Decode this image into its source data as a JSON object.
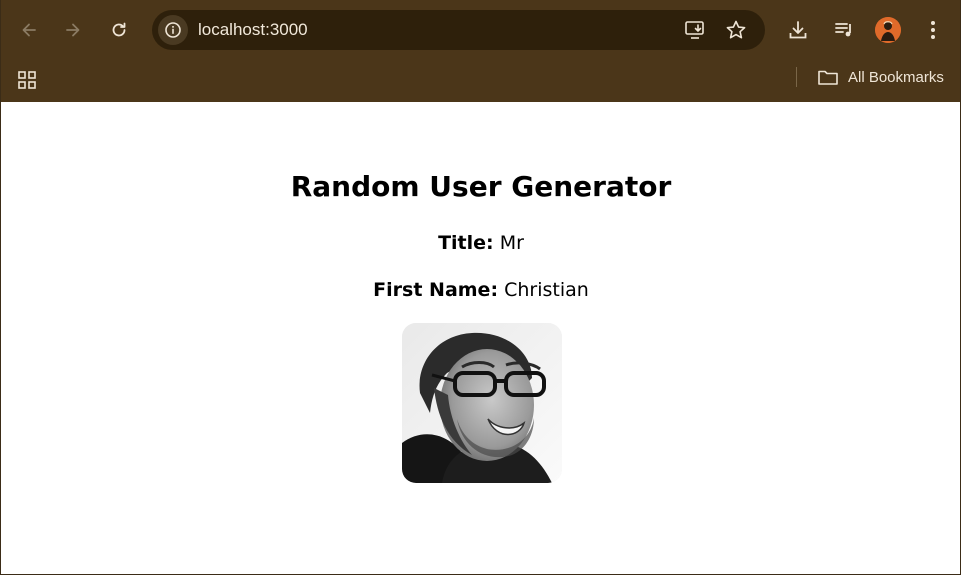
{
  "browser": {
    "url": "localhost:3000",
    "bookmarks_label": "All Bookmarks",
    "colors": {
      "frame": "#4b3619",
      "omnibox": "#2e200b",
      "avatar": "#e06a2a"
    },
    "icons": [
      "back-arrow-icon",
      "forward-arrow-icon",
      "reload-icon",
      "site-info-icon",
      "install-app-icon",
      "star-icon",
      "download-icon",
      "media-control-icon",
      "profile-avatar",
      "menu-dots-icon",
      "apps-grid-icon",
      "folder-icon"
    ]
  },
  "page": {
    "heading": "Random User Generator",
    "title_label": "Title:",
    "title_value": "Mr",
    "first_name_label": "First Name:",
    "first_name_value": "Christian",
    "photo_icon": "user-portrait-photo"
  }
}
